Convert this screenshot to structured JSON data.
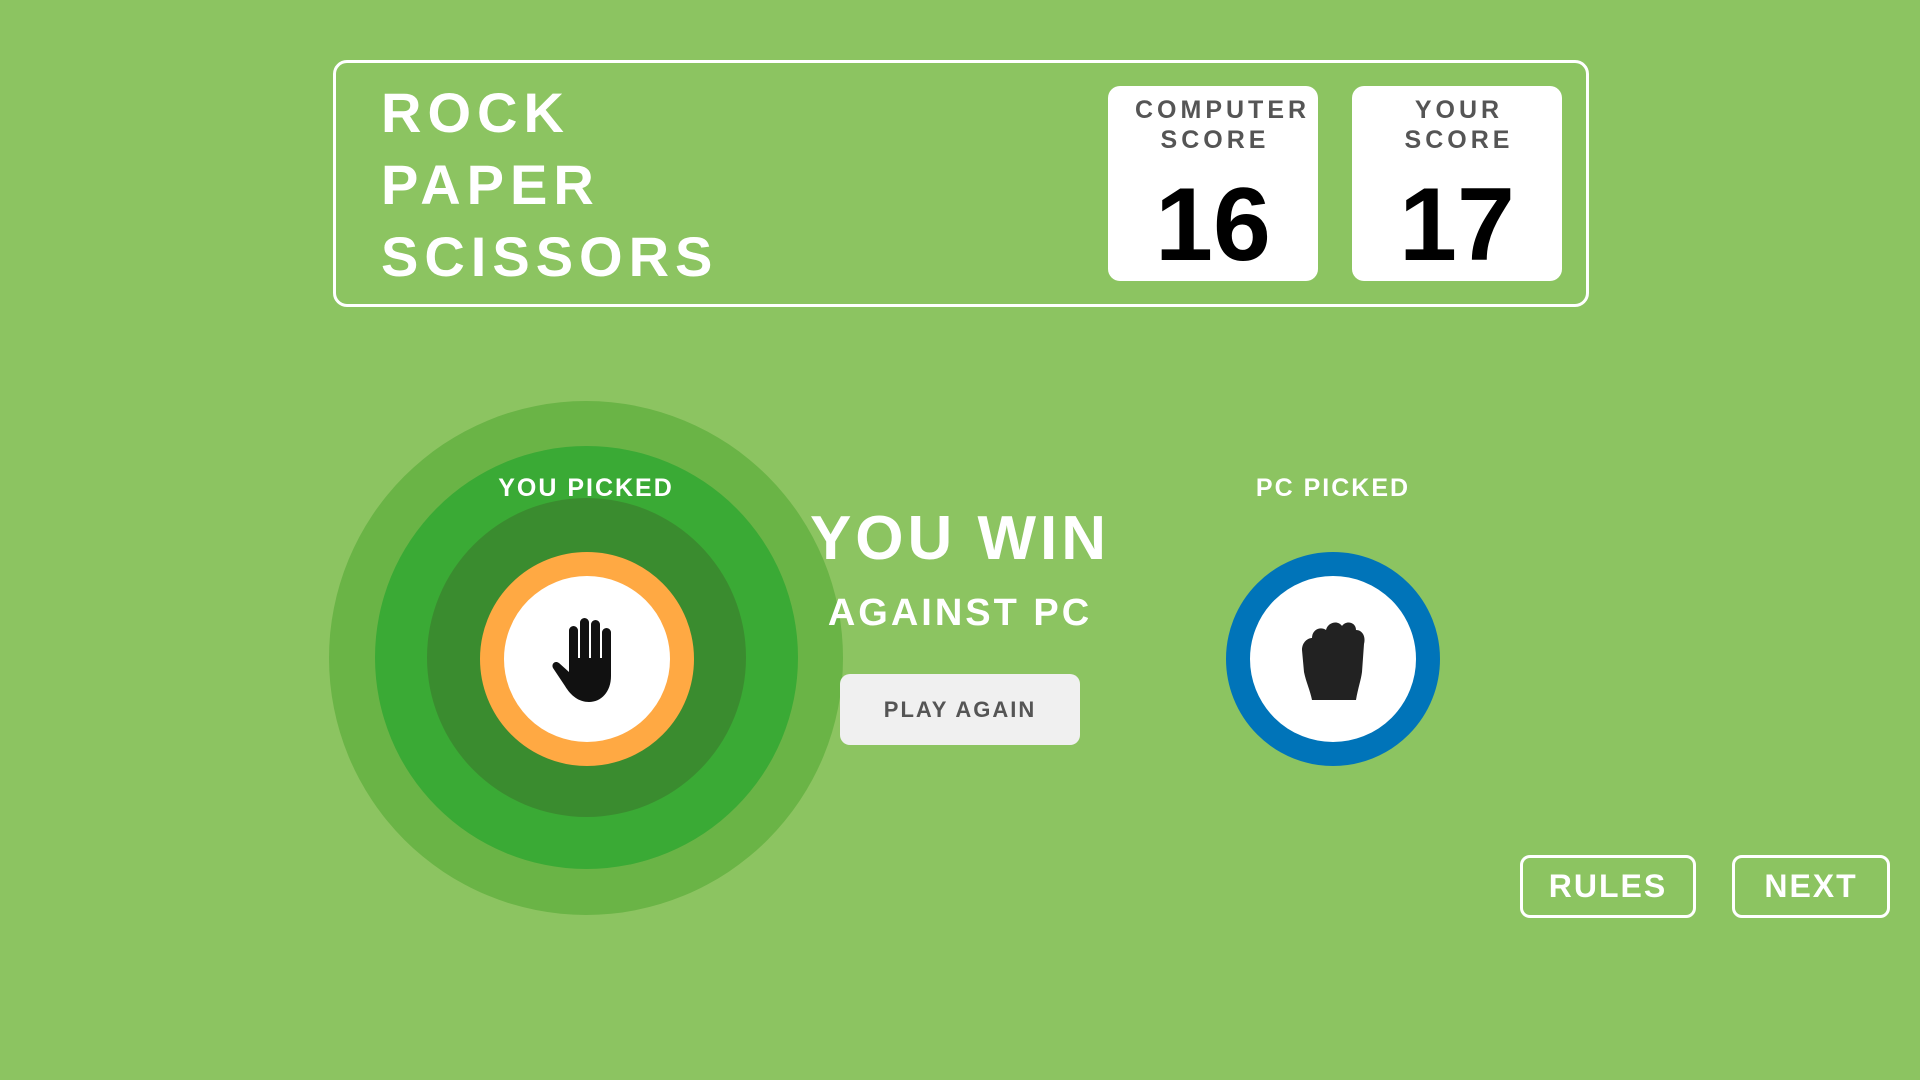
{
  "header": {
    "title_lines": [
      "ROCK",
      "PAPER",
      "SCISSORS"
    ],
    "computer_score_label": "COMPUTER SCORE",
    "computer_score": "16",
    "your_score_label": "YOUR SCORE",
    "your_score": "17"
  },
  "player": {
    "label": "YOU PICKED",
    "choice_icon": "paper-hand-icon",
    "ring_color": "#ffa943"
  },
  "computer": {
    "label": "PC PICKED",
    "choice_icon": "rock-fist-icon",
    "ring_color": "#0074b9"
  },
  "result": {
    "title": "YOU WIN",
    "subtitle": "AGAINST PC",
    "play_again_label": "PLAY AGAIN"
  },
  "footer": {
    "rules_label": "RULES",
    "next_label": "NEXT"
  },
  "colors": {
    "background": "#8cc461",
    "win_ring_outer": "#6ab446",
    "win_ring_middle": "#3aaa35",
    "win_ring_inner": "#3a8c2f"
  }
}
